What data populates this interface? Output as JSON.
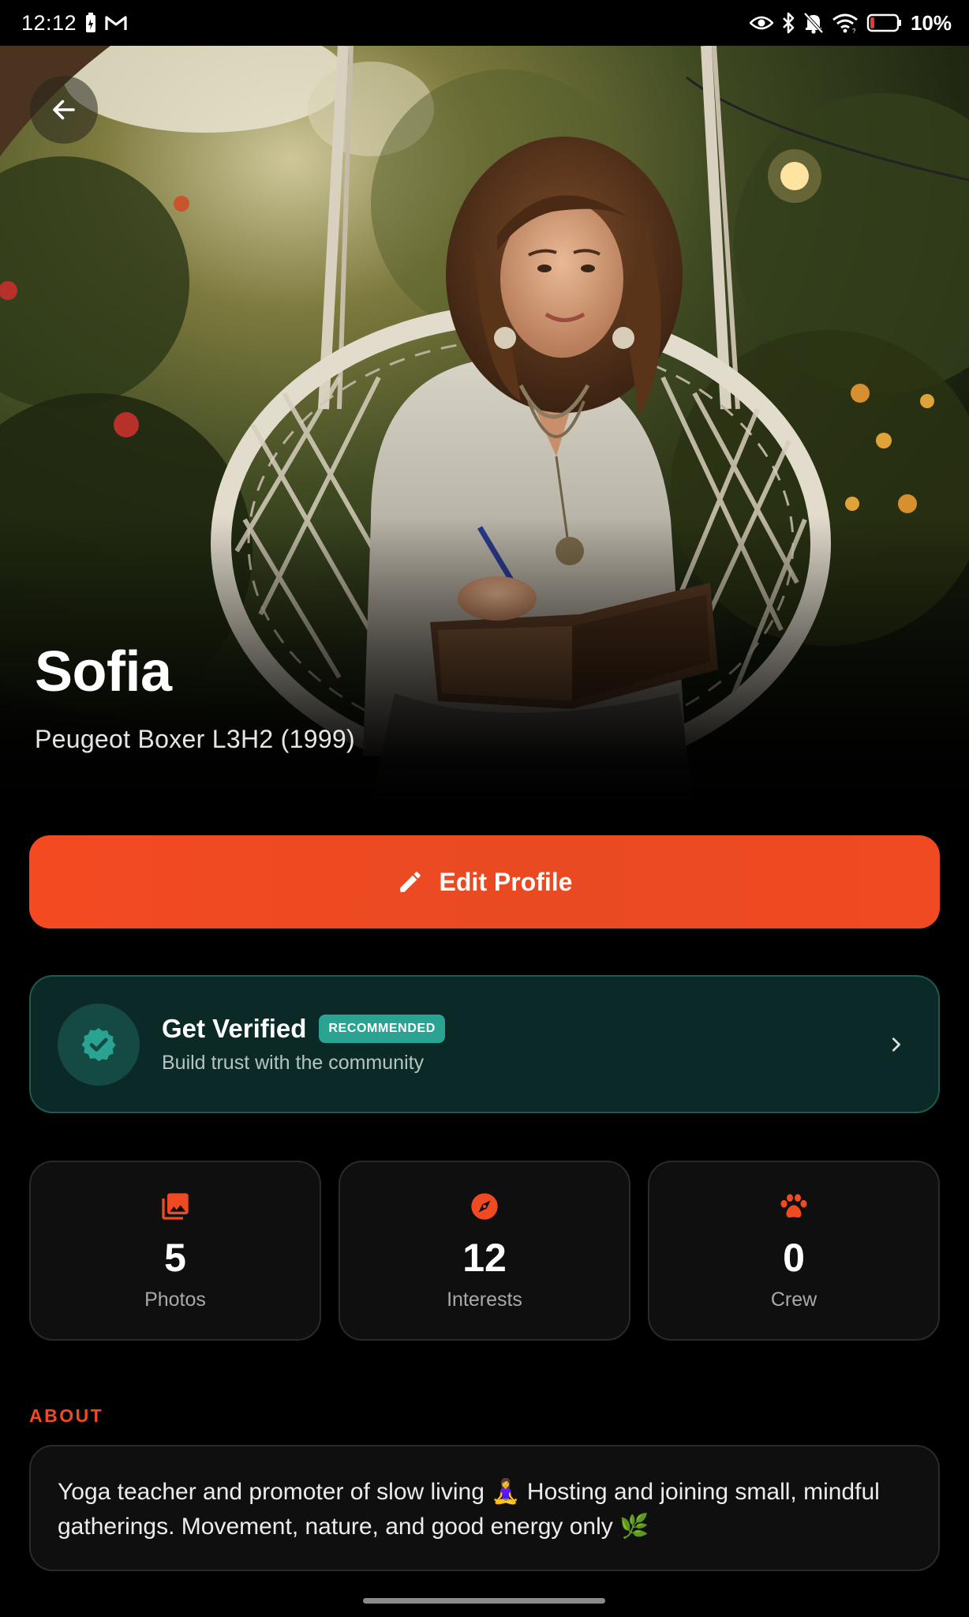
{
  "status_bar": {
    "time": "12:12",
    "battery_percent": "10%",
    "icons_left": [
      "battery-saver-icon",
      "gmail-icon"
    ],
    "icons_right": [
      "eye-icon",
      "bluetooth-icon",
      "bell-off-icon",
      "wifi-icon",
      "battery-icon"
    ]
  },
  "header": {
    "back_icon": "arrow-left-icon"
  },
  "profile": {
    "name": "Sofia",
    "vehicle": "Peugeot Boxer L3H2 (1999)"
  },
  "edit_button": {
    "label": "Edit Profile",
    "icon": "pencil-icon"
  },
  "verify": {
    "title": "Get Verified",
    "badge": "RECOMMENDED",
    "subtitle": "Build trust with the community",
    "icon": "verified-badge-icon"
  },
  "stats": [
    {
      "value": "5",
      "label": "Photos",
      "icon": "photo-library-icon"
    },
    {
      "value": "12",
      "label": "Interests",
      "icon": "compass-icon"
    },
    {
      "value": "0",
      "label": "Crew",
      "icon": "paw-icon"
    }
  ],
  "about": {
    "label": "ABOUT",
    "text": "Yoga teacher and promoter of slow living 🧘‍♀️ Hosting and joining small, mindful gatherings. Movement, nature, and good energy only 🌿"
  },
  "colors": {
    "accent": "#f04a22",
    "verify_bg": "#0b2a27",
    "verify_badge": "#2aa392",
    "card_bg": "#0f0f0f"
  }
}
